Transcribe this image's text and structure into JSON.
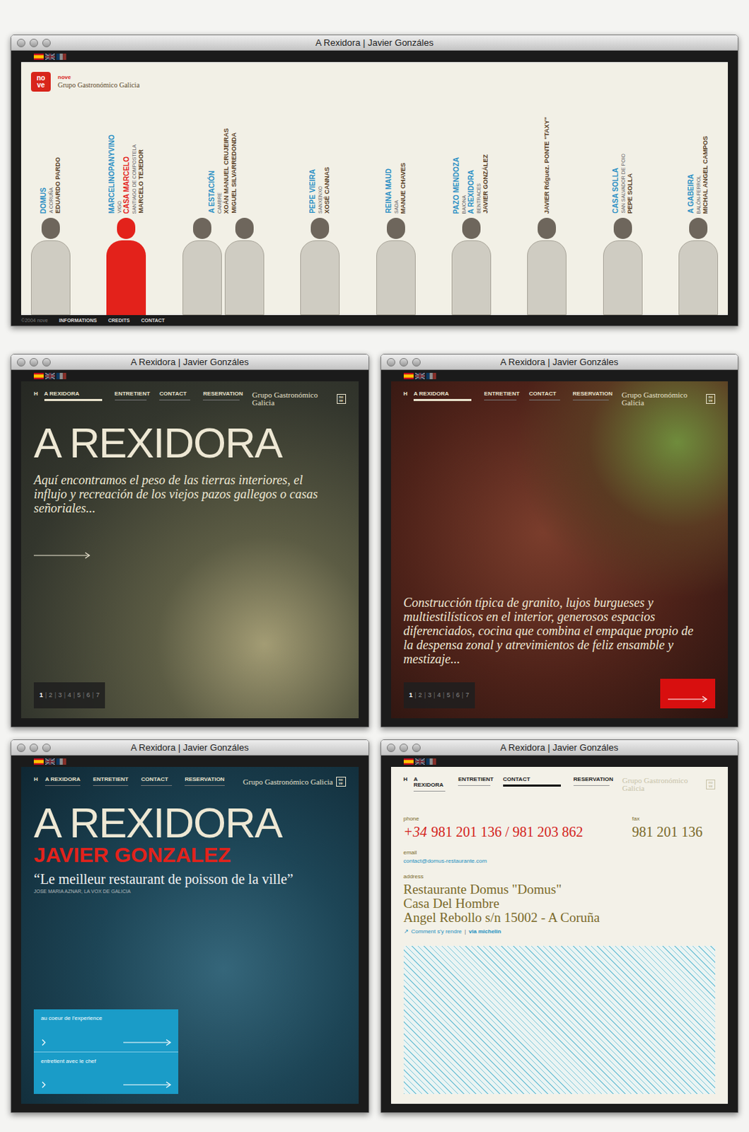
{
  "desktop": {
    "windows": [
      {
        "kind": "home",
        "title": "A Rexidora | Javier Gonzáles",
        "languages": [
          {
            "kind": "es",
            "selected": true
          },
          {
            "kind": "en",
            "selected": false
          },
          {
            "kind": "fr",
            "selected": false
          }
        ],
        "logo": {
          "mark": [
            "no",
            "ve"
          ],
          "name": "nove",
          "tagline": "Grupo Gastronómico Galicia"
        },
        "chefs": [
          {
            "places": [
              {
                "name": "DOMUS",
                "city": "A CORUÑA",
                "selected": false
              }
            ],
            "chefs": [
              "EDUARDO PARDO"
            ],
            "selected": false
          },
          {
            "places": [
              {
                "name": "MARCELINOPANYVINO",
                "city": "VIGO",
                "selected": false
              },
              {
                "name": "CASA MARCELO",
                "city": "SANTIAGO DE COMPOSTELA",
                "selected": true
              }
            ],
            "chefs": [
              "MARCELO TEJEDOR"
            ],
            "selected": true
          },
          {
            "places": [
              {
                "name": "A ESTACIÓN",
                "city": "CAMBRE",
                "selected": false
              }
            ],
            "chefs": [
              "XOÁN MANUEL CRUJEIRAS",
              "MIGUEL SILVARREDONDA"
            ],
            "selected": false
          },
          {
            "places": [
              {
                "name": "PEPE VIEIRA",
                "city": "SANXENXO",
                "selected": false
              }
            ],
            "chefs": [
              "XOSÉ CANNAS"
            ],
            "selected": false
          },
          {
            "places": [
              {
                "name": "REINA MAUD",
                "city": "SADA",
                "selected": false
              }
            ],
            "chefs": [
              "MANUE CHAVES"
            ],
            "selected": false
          },
          {
            "places": [
              {
                "name": "PAZO MENDOZA",
                "city": "BAIONA",
                "selected": false
              },
              {
                "name": "A REXIDORA",
                "city": "BENTRACES",
                "selected": false
              }
            ],
            "chefs": [
              "JAVIER GONZÁLEZ"
            ],
            "selected": false
          },
          {
            "places": [],
            "chefs": [
              "JAVIER Rdguez. PONTE \"TAXY\""
            ],
            "selected": false
          },
          {
            "places": [
              {
                "name": "CASA SOLLA",
                "city": "SAN SALVADOR DE POIO",
                "selected": false
              }
            ],
            "chefs": [
              "PEPE SOLLA"
            ],
            "selected": false
          },
          {
            "places": [
              {
                "name": "A GABEIRA",
                "city": "BALÓN-FERROL",
                "selected": false
              }
            ],
            "chefs": [
              "MICHAL ANGEL CAMPOS"
            ],
            "selected": false
          }
        ],
        "footer": {
          "copyright": "©2004 nove",
          "links": [
            "INFORMATIONS",
            "CREDITS",
            "CONTACT"
          ]
        }
      },
      {
        "kind": "intro",
        "title": "A Rexidora | Javier Gonzáles",
        "languages": [
          {
            "kind": "es",
            "selected": true
          },
          {
            "kind": "en",
            "selected": false
          },
          {
            "kind": "fr",
            "selected": false
          }
        ],
        "nav": {
          "home": "H",
          "items": [
            {
              "label": "A REXIDORA",
              "selected": true
            },
            {
              "label": "ENTRETIENT",
              "selected": false
            },
            {
              "label": "CONTACT",
              "selected": false
            },
            {
              "label": "RESERVATION",
              "selected": false
            }
          ],
          "brand": "Grupo Gastronómico Galicia",
          "badge": [
            "no",
            "ve"
          ],
          "dim": false
        },
        "heading": "A REXIDORA",
        "text": "Aquí encontramos el peso de las tierras interiores, el influjo y recreación de los viejos pazos gallegos o casas señoriales...",
        "pager": {
          "separator": "|",
          "pages": [
            {
              "label": "1",
              "selected": true
            },
            {
              "label": "2",
              "selected": false
            },
            {
              "label": "3",
              "selected": false
            },
            {
              "label": "4",
              "selected": false
            },
            {
              "label": "5",
              "selected": false
            },
            {
              "label": "6",
              "selected": false
            },
            {
              "label": "7",
              "selected": false
            }
          ]
        }
      },
      {
        "kind": "story",
        "title": "A Rexidora | Javier Gonzáles",
        "languages": [
          {
            "kind": "es",
            "selected": true
          },
          {
            "kind": "en",
            "selected": false
          },
          {
            "kind": "fr",
            "selected": false
          }
        ],
        "nav": {
          "home": "H",
          "items": [
            {
              "label": "A REXIDORA",
              "selected": true
            },
            {
              "label": "ENTRETIENT",
              "selected": false
            },
            {
              "label": "CONTACT",
              "selected": false
            },
            {
              "label": "RESERVATION",
              "selected": false
            }
          ],
          "brand": "Grupo Gastronómico Galicia",
          "badge": [
            "no",
            "ve"
          ],
          "dim": false
        },
        "text": "Construcción típica de granito, lujos burgueses y multiestilísticos en el interior, generosos espacios diferenciados, cocina que combina el empaque propio de la despensa zonal y atrevimientos de feliz ensamble y mestizaje...",
        "pager": {
          "separator": "|",
          "pages": [
            {
              "label": "1",
              "selected": true
            },
            {
              "label": "2",
              "selected": false
            },
            {
              "label": "3",
              "selected": false
            },
            {
              "label": "4",
              "selected": false
            },
            {
              "label": "5",
              "selected": false
            },
            {
              "label": "6",
              "selected": false
            },
            {
              "label": "7",
              "selected": false
            }
          ]
        }
      },
      {
        "kind": "chef",
        "title": "A Rexidora | Javier Gonzáles",
        "languages": [
          {
            "kind": "es",
            "selected": true
          },
          {
            "kind": "en",
            "selected": false
          },
          {
            "kind": "fr",
            "selected": false
          }
        ],
        "nav": {
          "home": "H",
          "items": [
            {
              "label": "A REXIDORA",
              "selected": false
            },
            {
              "label": "ENTRETIENT",
              "selected": false
            },
            {
              "label": "CONTACT",
              "selected": false
            },
            {
              "label": "RESERVATION",
              "selected": false
            }
          ],
          "brand": "Grupo Gastronómico Galicia",
          "badge": [
            "no",
            "ve"
          ],
          "dim": false
        },
        "heading": "A REXIDORA",
        "subheading": "JAVIER GONZALEZ",
        "quote": "“Le meilleur restaurant de poisson de la ville”",
        "source": "JOSE MARIA AZNAR, LA VOX DE GALICIA",
        "links": [
          "au coeur de l'experience",
          "entretient avec le chef"
        ]
      },
      {
        "kind": "contact",
        "title": "A Rexidora | Javier Gonzáles",
        "languages": [
          {
            "kind": "es",
            "selected": true
          },
          {
            "kind": "en",
            "selected": false
          },
          {
            "kind": "fr",
            "selected": false
          }
        ],
        "nav": {
          "home": "H",
          "items": [
            {
              "label": "A REXIDORA",
              "selected": false
            },
            {
              "label": "ENTRETIENT",
              "selected": false
            },
            {
              "label": "CONTACT",
              "selected": true
            },
            {
              "label": "RESERVATION",
              "selected": false
            }
          ],
          "brand": "Grupo Gastronómico Galicia",
          "badge": [
            "no",
            "ve"
          ],
          "dim": true
        },
        "contact": {
          "phone": {
            "label": "phone",
            "prefix": "+34",
            "value": "981 201 136 / 981 203 862"
          },
          "fax": {
            "label": "fax",
            "value": "981 201 136"
          },
          "email": {
            "label": "email",
            "value": "contact@domus-restaurante.com"
          },
          "address": {
            "label": "address",
            "lines": [
              "Restaurante Domus \"Domus\"",
              "Casa Del Hombre",
              "Angel Rebollo s/n 15002 - A Coruña"
            ]
          },
          "directions": {
            "icon": "↗",
            "label": "Comment s'y rendre",
            "separator": "|",
            "link": "via michelin"
          }
        }
      }
    ]
  }
}
